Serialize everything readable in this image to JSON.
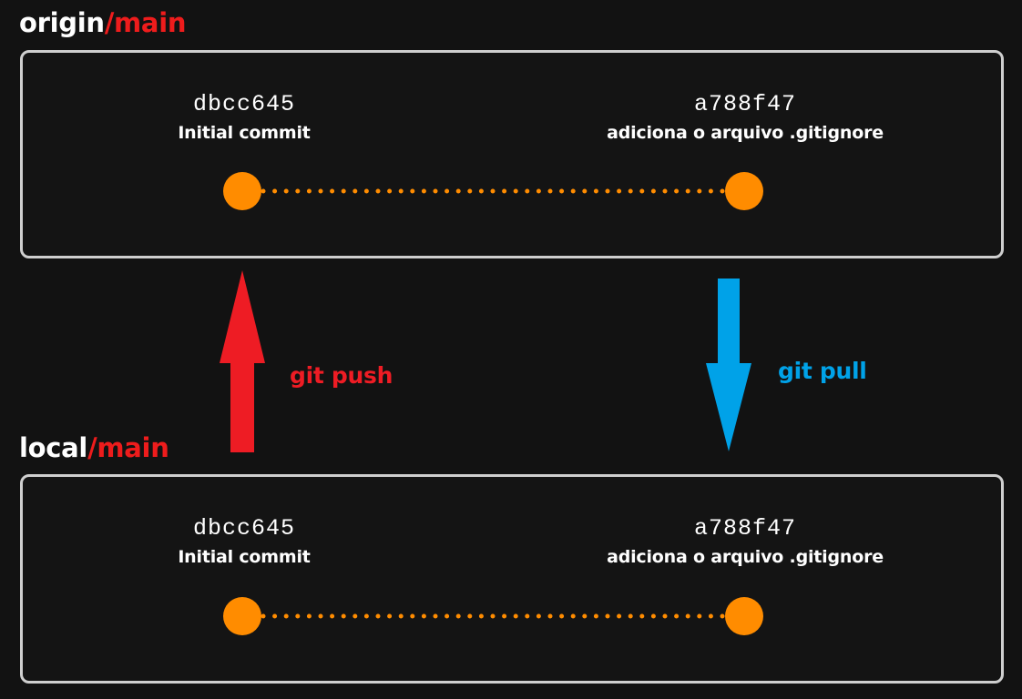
{
  "origin": {
    "remote": "origin",
    "branch": "/main",
    "commits": [
      {
        "hash": "dbcc645",
        "message": "Initial commit"
      },
      {
        "hash": "a788f47",
        "message": "adiciona o arquivo .gitignore"
      }
    ]
  },
  "local": {
    "remote": "local",
    "branch": "/main",
    "commits": [
      {
        "hash": "dbcc645",
        "message": "Initial commit"
      },
      {
        "hash": "a788f47",
        "message": "adiciona o arquivo .gitignore"
      }
    ]
  },
  "actions": {
    "push": "git push",
    "pull": "git pull"
  },
  "colors": {
    "background": "#121212",
    "panel_border": "#cfcfcf",
    "commit_node": "#ff8c00",
    "push": "#ee1c24",
    "pull": "#00a2e8",
    "branch_accent": "#ee1c1c"
  }
}
